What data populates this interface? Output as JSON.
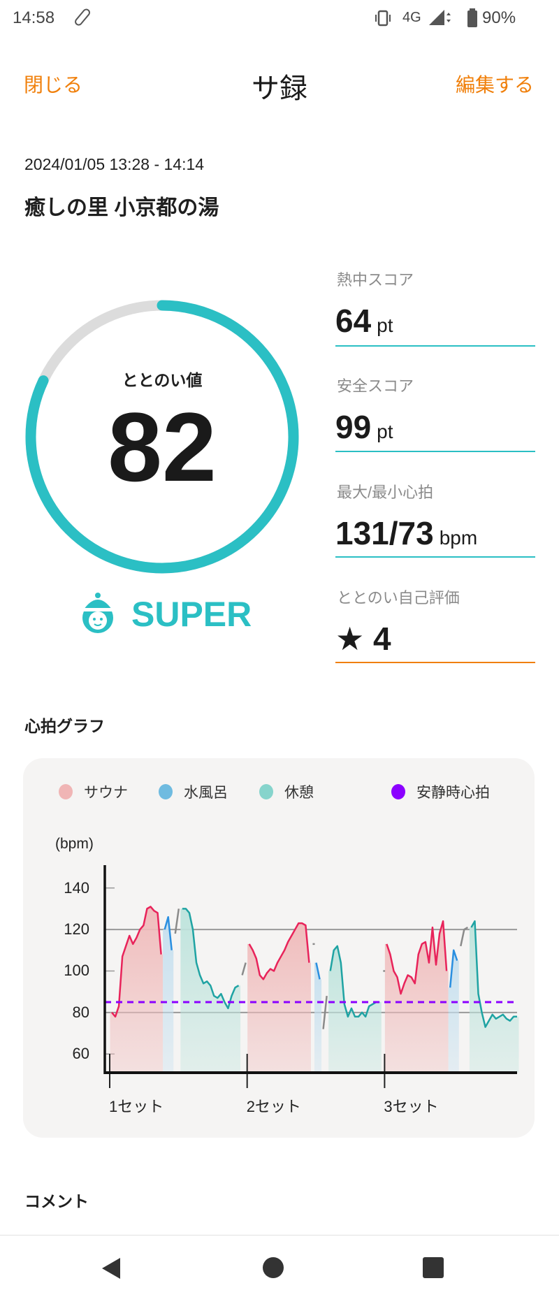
{
  "status": {
    "time": "14:58",
    "network": "4G",
    "battery": "90%"
  },
  "header": {
    "close": "閉じる",
    "title": "サ録",
    "edit": "編集する"
  },
  "record": {
    "datetime": "2024/01/05 13:28 - 14:14",
    "venue": "癒しの里 小京都の湯"
  },
  "totonoi": {
    "label": "ととのい値",
    "value": "82",
    "progress_percent": 82,
    "rank": "SUPER",
    "ring_color": "#2bbfc4"
  },
  "scores": [
    {
      "label": "熱中スコア",
      "value": "64",
      "unit": "pt"
    },
    {
      "label": "安全スコア",
      "value": "99",
      "unit": "pt"
    },
    {
      "label": "最大/最小心拍",
      "value": "131/73",
      "unit": "bpm"
    },
    {
      "label": "ととのい自己評価",
      "value": "★ 4",
      "unit": ""
    }
  ],
  "graph_title": "心拍グラフ",
  "comment_title": "コメント",
  "chart_data": {
    "type": "line",
    "ylabel": "(bpm)",
    "yticks": [
      60,
      80,
      100,
      120,
      140
    ],
    "ylim": [
      51,
      151
    ],
    "gridlines": [
      80,
      120
    ],
    "resting_hr": 85,
    "legend": [
      {
        "name": "サウナ",
        "color": "#f0b5b5"
      },
      {
        "name": "水風呂",
        "color": "#6fbbe0"
      },
      {
        "name": "休憩",
        "color": "#86d4cc"
      },
      {
        "name": "安静時心拍",
        "color": "#8b00ff"
      }
    ],
    "phase_colors": {
      "sauna": {
        "line": "#e8235a",
        "fill": "#f0bcbc"
      },
      "cold": {
        "line": "#2a8fe0",
        "fill": "#c6e0ef"
      },
      "rest": {
        "line": "#1fa3a3",
        "fill": "#bfe4dd"
      },
      "other": {
        "line": "#8a8a8a",
        "fill": ""
      }
    },
    "segments": [
      {
        "phase": "sauna",
        "set": "1セット",
        "values": [
          80,
          78,
          83,
          107,
          112,
          117,
          113,
          116,
          120,
          122,
          130,
          131,
          129,
          128,
          108
        ]
      },
      {
        "phase": "cold",
        "values": [
          120,
          126,
          110
        ]
      },
      {
        "phase": "other",
        "values": [
          118,
          130
        ]
      },
      {
        "phase": "rest",
        "values": [
          130,
          130,
          128,
          120,
          104,
          98,
          94,
          95,
          93,
          88,
          87,
          89,
          85,
          82,
          88,
          92,
          93
        ]
      },
      {
        "phase": "other",
        "values": [
          98,
          104
        ]
      },
      {
        "phase": "sauna",
        "set": "2セット",
        "values": [
          113,
          110,
          106,
          98,
          96,
          99,
          101,
          100,
          104,
          107,
          110,
          114,
          117,
          120,
          123,
          123,
          122,
          104
        ]
      },
      {
        "phase": "other",
        "values": [
          113
        ]
      },
      {
        "phase": "cold",
        "values": [
          104,
          96
        ]
      },
      {
        "phase": "other",
        "values": [
          72,
          88
        ]
      },
      {
        "phase": "rest",
        "values": [
          100,
          110,
          112,
          104,
          84,
          78,
          82,
          78,
          78,
          80,
          78,
          83,
          84,
          85,
          85
        ]
      },
      {
        "phase": "other",
        "values": [
          100
        ]
      },
      {
        "phase": "sauna",
        "set": "3セット",
        "values": [
          113,
          108,
          100,
          97,
          89,
          94,
          98,
          97,
          94,
          108,
          113,
          114,
          104,
          121,
          103,
          118,
          124,
          100
        ]
      },
      {
        "phase": "cold",
        "values": [
          92,
          110,
          105
        ]
      },
      {
        "phase": "other",
        "values": [
          112,
          120,
          121
        ]
      },
      {
        "phase": "rest",
        "values": [
          121,
          124,
          89,
          80,
          73,
          76,
          79,
          77,
          78,
          79,
          77,
          76,
          78,
          78
        ]
      }
    ]
  }
}
